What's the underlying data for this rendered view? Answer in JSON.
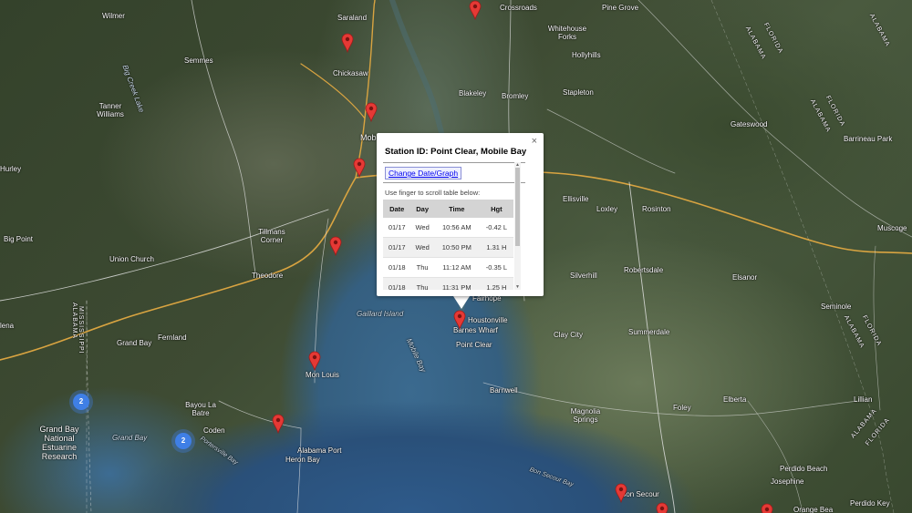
{
  "info_window": {
    "title": "Station ID: Point Clear, Mobile Bay",
    "change_button": "Change Date/Graph",
    "hint": "Use finger to scroll table below:",
    "columns": [
      "Date",
      "Day",
      "Time",
      "Hgt"
    ],
    "rows": [
      [
        "01/17",
        "Wed",
        "10:56 AM",
        "-0.42 L"
      ],
      [
        "01/17",
        "Wed",
        "10:50 PM",
        "1.31 H"
      ],
      [
        "01/18",
        "Thu",
        "11:12 AM",
        "-0.35 L"
      ],
      [
        "01/18",
        "Thu",
        "11:31 PM",
        "1.25 H"
      ]
    ],
    "close_glyph": "×"
  },
  "clusters": [
    "2",
    "2"
  ],
  "labels": {
    "wilmer": "Wilmer",
    "saraland": "Saraland",
    "crossroads": "Crossroads",
    "pine_grove": "Pine Grove",
    "whitehouse_forks": "Whitehouse Forks",
    "hollyhills": "Hollyhills",
    "semmes": "Semmes",
    "chickasaw": "Chickasaw",
    "big_creek_lake": "Big Creek Lake",
    "blakeley": "Blakeley",
    "bromley": "Bromley",
    "stapleton": "Stapleton",
    "tanner_williams": "Tanner Williams",
    "gateswood": "Gateswood",
    "barrineau_park": "Barrineau Park",
    "hurley": "Hurley",
    "mobile": "Mob",
    "ellisville": "Ellisville",
    "loxley": "Loxley",
    "rosinton": "Rosinton",
    "big_point": "Big Point",
    "union_church": "Union Church",
    "tillmans_corner": "Tillmans Corner",
    "theodore": "Theodore",
    "robertsdale": "Robertsdale",
    "silverhill": "Silverhill",
    "elsanor": "Elsanor",
    "seminole": "Seminole",
    "muscogee": "Muscoge",
    "fairhope": "Fairhope",
    "houstonville": "Houstonville",
    "barnes_wharf": "Barnes Wharf",
    "gaillard_island": "Gaillard Island",
    "grand_bay": "Grand Bay",
    "fernland": "Fernland",
    "point_clear": "Point Clear",
    "clay_city": "Clay City",
    "summerdale": "Summerdale",
    "mon_louis": "Mon Louis",
    "mobile_bay": "Mobile Bay",
    "barnwell": "Barnwell",
    "helena": "lena",
    "bayou_la_batre": "Bayou La Batre",
    "coden": "Coden",
    "magnolia_springs": "Magnolia Springs",
    "foley": "Foley",
    "elberta": "Elberta",
    "lillian": "Lillian",
    "grand_bay_research": "Grand Bay National Estuarine Research",
    "grand_bay_water": "Grand Bay",
    "portersville_bay": "Portersville Bay",
    "alabama_port": "Alabama Port",
    "heron_bay": "Heron Bay",
    "bon_secour_bay": "Bon Secour Bay",
    "bon_secour": "Bon Secour",
    "josephine": "Josephine",
    "perdido_beach": "Perdido Beach",
    "perdido_key": "Perdido Key",
    "orange_beach": "Orange Bea",
    "state_alabama_1": "ALABAMA",
    "state_florida_1": "FLORIDA",
    "state_alabama_2": "ALABAMA",
    "state_florida_2": "FLORIDA",
    "state_alabama_3": "ALABAMA",
    "state_florida_3": "FLORIDA",
    "state_alabama_4": "ALABAMA",
    "state_florida_4": "FLORIDA",
    "state_alabama_ms": "ALABAMA",
    "state_mississippi": "MISSISSIPPI"
  },
  "colors": {
    "pin": "#e53935",
    "cluster": "#3f7fe6",
    "water": "#2e5a8a"
  },
  "icons": {
    "pin": "map-marker-icon",
    "cluster": "marker-cluster-icon",
    "close": "close-icon"
  }
}
